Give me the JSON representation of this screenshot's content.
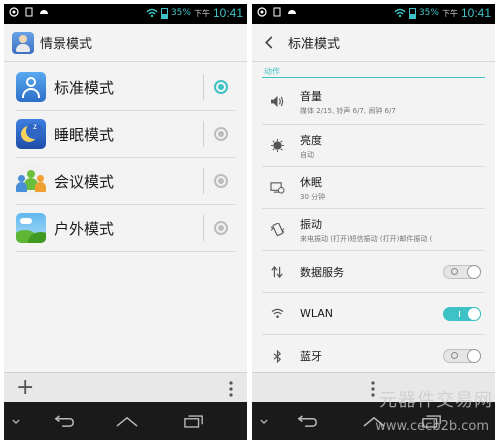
{
  "status_bar": {
    "battery_pct": "35%",
    "ampm": "下午",
    "time": "10:41",
    "icons": [
      "camera-icon",
      "sim-icon",
      "android-icon",
      "wifi-icon",
      "battery-icon"
    ]
  },
  "left_screen": {
    "title": "情景模式",
    "app_icon": "contacts-profile-icon",
    "modes": [
      {
        "label": "标准模式",
        "icon": "standard-mode-icon",
        "selected": true
      },
      {
        "label": "睡眠模式",
        "icon": "sleep-mode-icon",
        "selected": false
      },
      {
        "label": "会议模式",
        "icon": "meeting-mode-icon",
        "selected": false
      },
      {
        "label": "户外模式",
        "icon": "outdoor-mode-icon",
        "selected": false
      }
    ],
    "bottom": {
      "add_icon": "plus-icon",
      "menu_icon": "overflow-menu-icon"
    }
  },
  "right_screen": {
    "title": "标准模式",
    "section": "动作",
    "settings": [
      {
        "title": "音量",
        "subtitle": "媒体 2/15, 铃声 6/7, 闹钟 6/7",
        "icon": "volume-icon"
      },
      {
        "title": "亮度",
        "subtitle": "自动",
        "icon": "brightness-icon"
      },
      {
        "title": "休眠",
        "subtitle": "30 分钟",
        "icon": "sleep-timer-icon"
      },
      {
        "title": "振动",
        "subtitle": "来电振动 (打开)短信振动 (打开)邮件振动 (",
        "icon": "vibrate-icon"
      },
      {
        "title": "数据服务",
        "subtitle": "",
        "icon": "data-arrows-icon",
        "toggle": "off"
      },
      {
        "title": "WLAN",
        "subtitle": "",
        "icon": "wifi-icon",
        "toggle": "on"
      },
      {
        "title": "蓝牙",
        "subtitle": "",
        "icon": "bluetooth-icon",
        "toggle": "off"
      }
    ],
    "bottom": {
      "menu_icon": "overflow-menu-icon"
    }
  },
  "nav_bar": {
    "icons": [
      "chevron-down-icon",
      "back-icon",
      "home-icon",
      "recent-apps-icon"
    ]
  },
  "watermark": {
    "line1": "元器件交易网",
    "line2": "www.cecb2b.com"
  },
  "colors": {
    "accent": "#3fc2c6",
    "statusbar": "#000000",
    "navbar": "#1a1a1a",
    "background": "#f3f3f3"
  }
}
